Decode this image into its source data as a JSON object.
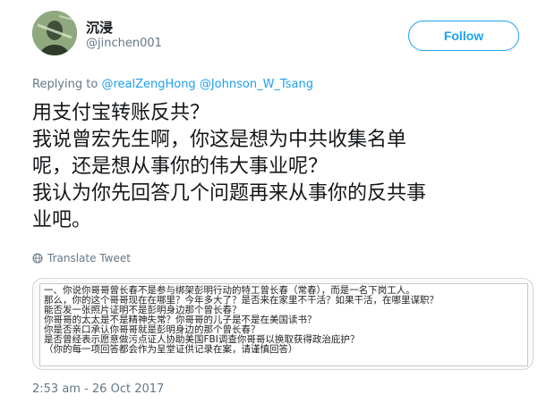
{
  "tweet": {
    "author": {
      "display_name": "沉浸",
      "handle": "@jinchen001"
    },
    "follow_label": "Follow",
    "reply_prefix": "Replying to",
    "reply_mentions": [
      "@realZengHong",
      "@Johnson_W_Tsang"
    ],
    "text_lines": [
      "用支付宝转账反共？",
      "我说曾宏先生啊，你这是想为中共收集名单",
      "呢，还是想从事你的伟大事业呢？",
      "我认为你先回答几个问题再来从事你的反共事",
      "业吧。"
    ],
    "translate_label": "Translate Tweet",
    "timestamp": "2:53 am - 26 Oct 2017",
    "image_text_lines": [
      "一、你说你哥哥曾长春不是参与绑架彭明行动的特工曾长春（常春），而是一名下岗工人。",
      "那么，你的这个哥哥现在在哪里？今年多大了？是否来在家里不干活？如果干活，在哪里谋职？",
      "能否发一张照片证明不是彭明身边那个曾长春？",
      "你哥哥的太太是不是精神失常？你哥哥的儿子是不是在美国读书？",
      "你是否亲口承认你哥哥就是彭明身边的那个曾长春？",
      "是否曾经表示愿意做污点证人协助美国FBI调查你哥哥以换取获得政治庇护？",
      "（你的每一项回答都会作为呈堂证供记录在案，请谨慎回答）"
    ]
  },
  "colors": {
    "accent": "#1da1f2",
    "secondary_text": "#657786",
    "primary_text": "#14171a"
  },
  "icons": {
    "globe": "globe-icon",
    "avatar": "avatar-image"
  }
}
